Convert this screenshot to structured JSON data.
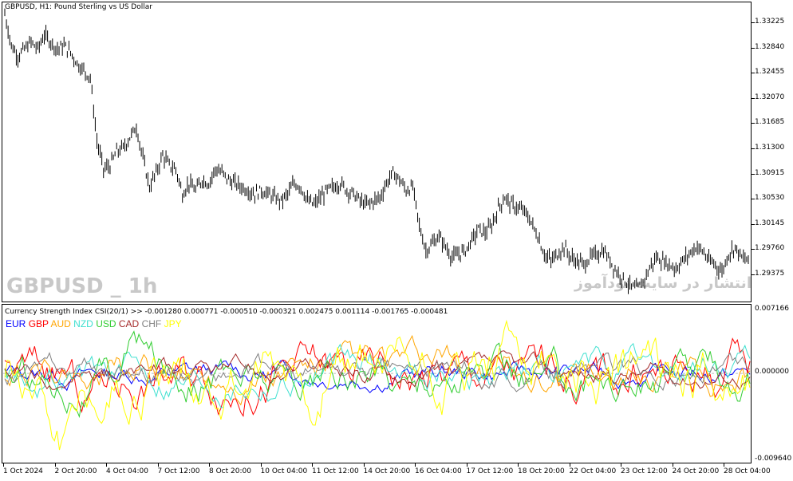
{
  "main_chart": {
    "title": "GBPUSD, H1:  Pound Sterling vs US Dollar",
    "watermark": "GBPUSD _ 1h",
    "watermark_fa": "انتشار در سایت نودآموز",
    "y_ticks": [
      "1.33225",
      "1.32840",
      "1.32455",
      "1.32070",
      "1.31685",
      "1.31300",
      "1.30915",
      "1.30530",
      "1.30145",
      "1.29760",
      "1.29375"
    ],
    "ylim": [
      1.292,
      1.334
    ],
    "bar_color": "#000000"
  },
  "indicator": {
    "title": "Currency Strength Index CSI(20/1) >> -0.001280 0.000771 -0.000510 -0.000321 0.002475 0.001114 -0.001765 -0.000481",
    "y_ticks": [
      "0.007166",
      "0.000000",
      "-0.009640"
    ],
    "legend": [
      {
        "name": "EUR",
        "color": "#0000ff"
      },
      {
        "name": "GBP",
        "color": "#ff0000"
      },
      {
        "name": "AUD",
        "color": "#ffa500"
      },
      {
        "name": "NZD",
        "color": "#40e0d0"
      },
      {
        "name": "USD",
        "color": "#32cd32"
      },
      {
        "name": "CAD",
        "color": "#a52a2a"
      },
      {
        "name": "CHF",
        "color": "#808080"
      },
      {
        "name": "JPY",
        "color": "#ffff00"
      }
    ]
  },
  "x_ticks": [
    "1 Oct 2024",
    "2 Oct 20:00",
    "4 Oct 04:00",
    "7 Oct 12:00",
    "8 Oct 20:00",
    "10 Oct 04:00",
    "11 Oct 12:00",
    "14 Oct 20:00",
    "16 Oct 04:00",
    "17 Oct 12:00",
    "18 Oct 20:00",
    "22 Oct 04:00",
    "23 Oct 12:00",
    "24 Oct 20:00",
    "28 Oct 04:00"
  ],
  "chart_data": {
    "type": "line",
    "price_series": [
      1.3325,
      1.328,
      1.3265,
      1.3275,
      1.3285,
      1.3275,
      1.3295,
      1.3285,
      1.3275,
      1.328,
      1.327,
      1.3255,
      1.3245,
      1.3235,
      1.3145,
      1.3105,
      1.311,
      1.313,
      1.3135,
      1.315,
      1.3165,
      1.312,
      1.308,
      1.31,
      1.3125,
      1.311,
      1.3105,
      1.307,
      1.3085,
      1.3075,
      1.309,
      1.3085,
      1.3105,
      1.31,
      1.309,
      1.3085,
      1.308,
      1.3075,
      1.307,
      1.3075,
      1.307,
      1.3065,
      1.306,
      1.307,
      1.3085,
      1.308,
      1.306,
      1.3055,
      1.3065,
      1.3075,
      1.308,
      1.3085,
      1.3075,
      1.307,
      1.306,
      1.3055,
      1.306,
      1.3065,
      1.3085,
      1.31,
      1.309,
      1.3075,
      1.308,
      1.3025,
      1.299,
      1.3,
      1.301,
      1.2995,
      1.298,
      1.2985,
      1.299,
      1.3005,
      1.302,
      1.3015,
      1.3025,
      1.305,
      1.3065,
      1.3055,
      1.305,
      1.3045,
      1.303,
      1.301,
      1.2985,
      1.2975,
      1.2985,
      1.2995,
      1.298,
      1.2975,
      1.297,
      1.298,
      1.2985,
      1.299,
      1.2975,
      1.296,
      1.295,
      1.294,
      1.2935,
      1.2945,
      1.2965,
      1.298,
      1.2975,
      1.297,
      1.2965,
      1.2975,
      1.2985,
      1.2995,
      1.299,
      1.2975,
      1.297,
      1.296,
      1.2985,
      1.2995,
      1.298,
      1.2975
    ],
    "csi_ylim": [
      -0.00964,
      0.007166
    ]
  }
}
